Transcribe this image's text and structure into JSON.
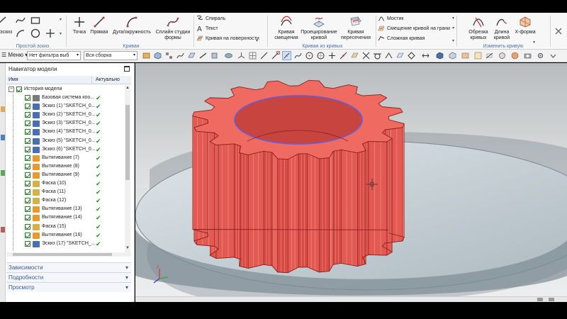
{
  "ribbon": {
    "groups": [
      {
        "label": "Простой эскиз"
      },
      {
        "label": "Кривая"
      },
      {
        "label": "Кривая из кривых"
      },
      {
        "label": "Изменить кривую"
      }
    ],
    "sketch_partial_label": "эскиз",
    "curve_buttons": [
      {
        "label": "Точка"
      },
      {
        "label": "Прямая"
      },
      {
        "label": "Дуга/окружность"
      },
      {
        "label": "Сплайн студии формы"
      }
    ],
    "curve_small": [
      {
        "label": "Спираль"
      },
      {
        "label": "Текст"
      },
      {
        "label": "Кривая на поверхности"
      }
    ],
    "derived_buttons": [
      {
        "label": "Кривая смещения"
      },
      {
        "label": "Проецирование кривой"
      },
      {
        "label": "Кривая пересечения"
      }
    ],
    "derived_small": [
      {
        "label": "Мостик"
      },
      {
        "label": "Смещение кривой на грани"
      },
      {
        "label": "Сложная кривая"
      }
    ],
    "edit_buttons": [
      {
        "label": "Обрезка кривых"
      },
      {
        "label": "Длина кривой"
      },
      {
        "label": "X-форма"
      }
    ]
  },
  "toolbar": {
    "menu_label": "Меню",
    "filter_value": "Нет фильтра выб",
    "assembly_value": "Вся сборка"
  },
  "navigator": {
    "title": "Навигатор модели",
    "columns": {
      "name": "Имя",
      "status": "Актуально"
    },
    "history_label": "История модели",
    "items": [
      {
        "label": "Базовая система коо...",
        "type": "csys",
        "ok": "✔"
      },
      {
        "label": "Эскиз (1) \"SKETCH_0...",
        "type": "sketch",
        "ok": "✔"
      },
      {
        "label": "Эскиз (2) \"SKETCH_0...",
        "type": "sketch",
        "ok": "✔"
      },
      {
        "label": "Эскиз (3) \"SKETCH_0...",
        "type": "sketch",
        "ok": "✔"
      },
      {
        "label": "Эскиз (4) \"SKETCH_0...",
        "type": "sketch",
        "ok": "✔"
      },
      {
        "label": "Эскиз (5) \"SKETCH_0...",
        "type": "sketch",
        "ok": "✔"
      },
      {
        "label": "Эскиз (6) \"SKETCH_0...",
        "type": "sketch",
        "ok": "✔"
      },
      {
        "label": "Вытягивание (7)",
        "type": "extrude",
        "ok": "✔"
      },
      {
        "label": "Вытягивание (8)",
        "type": "extrude",
        "ok": "✔"
      },
      {
        "label": "Вытягивание (9)",
        "type": "extrude",
        "ok": "✔"
      },
      {
        "label": "Фаска (10)",
        "type": "chamfer",
        "ok": "✔"
      },
      {
        "label": "Фаска (11)",
        "type": "chamfer",
        "ok": "✔"
      },
      {
        "label": "Фаска (12)",
        "type": "chamfer",
        "ok": "✔"
      },
      {
        "label": "Вытягивание (13)",
        "type": "extrude",
        "ok": "✔"
      },
      {
        "label": "Вытягивание (14)",
        "type": "extrude",
        "ok": "✔"
      },
      {
        "label": "Фаска (15)",
        "type": "chamfer",
        "ok": "✔"
      },
      {
        "label": "Вытягивание (16)",
        "type": "extrude",
        "ok": "✔"
      },
      {
        "label": "Эскиз (17) \"SKETCH_...",
        "type": "sketch",
        "ok": "✔"
      }
    ],
    "sections": [
      {
        "label": "Зависимости"
      },
      {
        "label": "Подробности"
      },
      {
        "label": "Просмотр"
      }
    ]
  },
  "icons": {
    "sketch": "sketch-icon",
    "extrude": "extrude-icon",
    "chamfer": "chamfer-icon",
    "csys": "coordinate-system-icon"
  },
  "colors": {
    "gear": "#e0574f",
    "gear_edge": "#8a1f1a",
    "selection": "#7a5fd6",
    "check": "#1c9a1c",
    "link": "#3b5b92"
  }
}
